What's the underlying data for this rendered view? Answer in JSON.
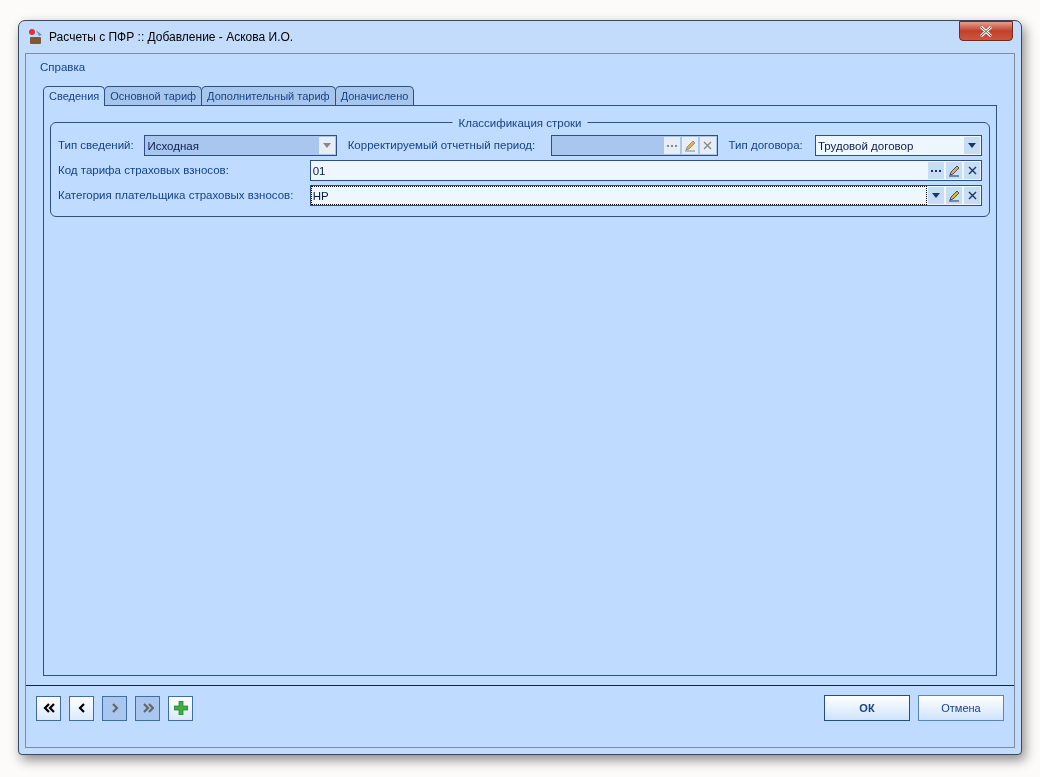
{
  "window": {
    "title": "Расчеты с ПФР :: Добавление - Аскова И.О."
  },
  "menu": [
    {
      "label": "Справка"
    }
  ],
  "tabs": [
    {
      "label": "Сведения",
      "selected": true
    },
    {
      "label": "Основной тариф",
      "selected": false
    },
    {
      "label": "Дополнительный тариф",
      "selected": false
    },
    {
      "label": "Доначислено",
      "selected": false
    }
  ],
  "group": {
    "title": "Классификация строки",
    "rows": [
      [
        {
          "label": "Тип сведений:",
          "value": "Исходная",
          "kind": "combo",
          "disabled": true,
          "focused": false
        },
        {
          "label": "Корректируемый отчетный период:",
          "kind": "lookup",
          "disabled": true,
          "focused": false
        },
        {
          "label": "Тип договора:",
          "value": "Трудовой договор",
          "kind": "combo",
          "disabled": false,
          "focused": false
        }
      ],
      [
        {
          "label": "Код тарифа страховых взносов:",
          "value": "01",
          "kind": "lookup",
          "disabled": false,
          "focused": false
        }
      ],
      [
        {
          "label": "Категория плательщика страховых взносов:",
          "value": "НР",
          "kind": "combo_lookup",
          "disabled": false,
          "focused": true
        }
      ]
    ]
  },
  "nav_buttons": [
    {
      "kind": "first",
      "disabled": false
    },
    {
      "kind": "prev",
      "disabled": false
    },
    {
      "kind": "next",
      "disabled": true
    },
    {
      "kind": "last",
      "disabled": true
    },
    {
      "kind": "add",
      "disabled": false
    }
  ],
  "buttons": [
    {
      "label": "ОК",
      "default": true
    },
    {
      "label": "Отмена",
      "default": false
    }
  ]
}
